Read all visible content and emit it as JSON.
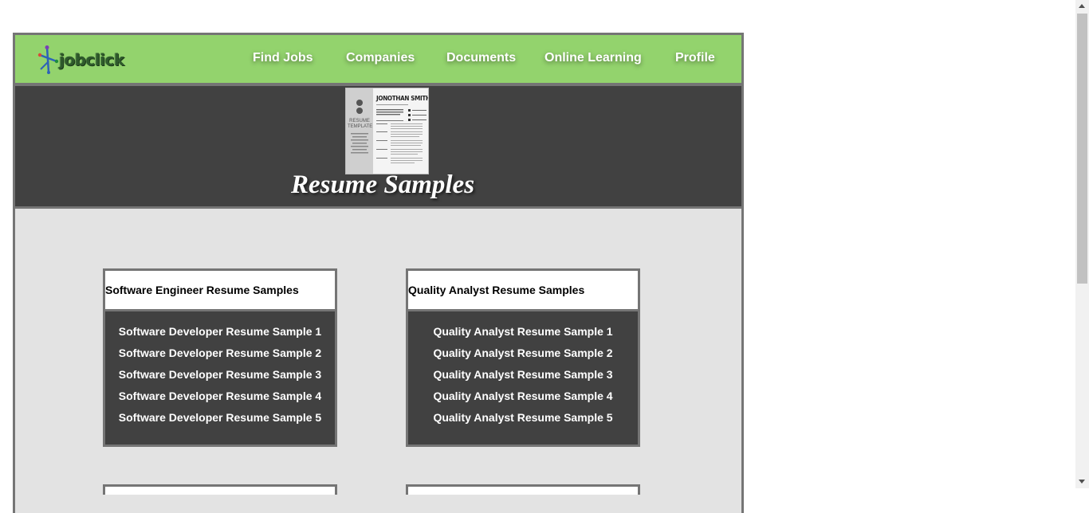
{
  "brand": {
    "logo_text": "jobclick"
  },
  "nav": {
    "items": [
      {
        "label": "Find Jobs"
      },
      {
        "label": "Companies"
      },
      {
        "label": "Documents"
      },
      {
        "label": "Online Learning"
      },
      {
        "label": "Profile"
      }
    ]
  },
  "hero": {
    "thumb_name": "JONOTHAN SMITH",
    "thumb_side_title": "RESUME TEMPLATE",
    "title": "Resume Samples"
  },
  "cards": [
    {
      "title": "Software Engineer Resume Samples",
      "links": [
        "Software Developer Resume Sample 1",
        "Software Developer Resume Sample 2",
        "Software Developer Resume Sample 3",
        "Software Developer Resume Sample 4",
        "Software Developer Resume Sample 5"
      ]
    },
    {
      "title": "Quality Analyst Resume Samples",
      "links": [
        "Quality Analyst Resume Sample 1",
        "Quality Analyst Resume Sample 2",
        "Quality Analyst Resume Sample 3",
        "Quality Analyst Resume Sample 4",
        "Quality Analyst Resume Sample 5"
      ]
    }
  ],
  "colors": {
    "nav_bg": "#93d36d",
    "hero_bg": "#414141",
    "content_bg": "#e3e3e3",
    "border": "#757575"
  }
}
